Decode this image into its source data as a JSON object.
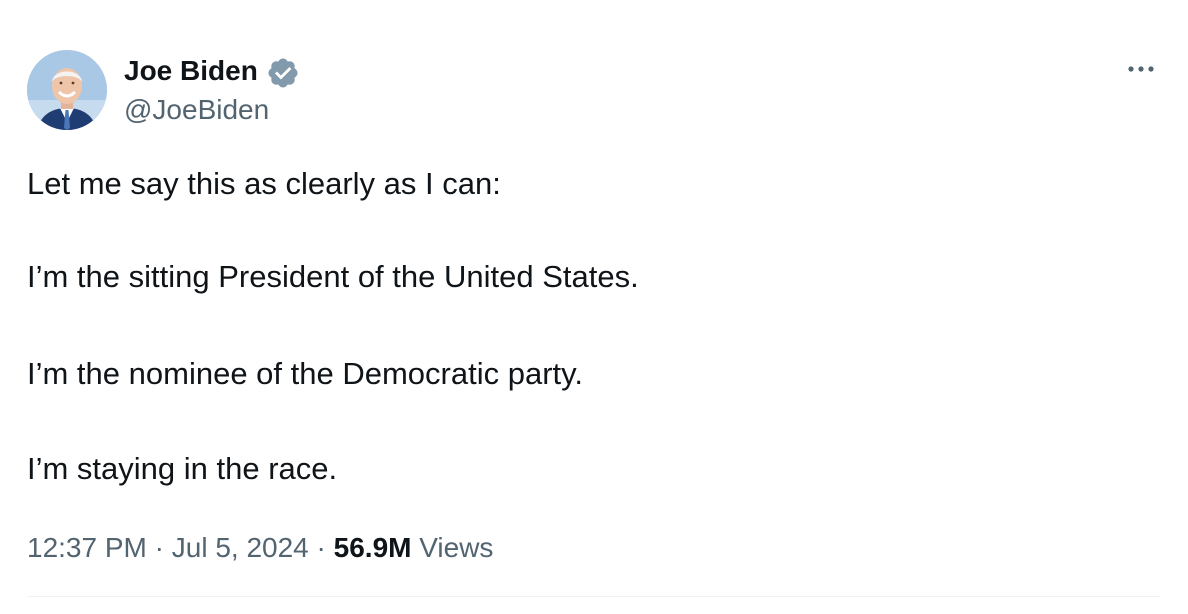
{
  "author": {
    "name": "Joe Biden",
    "handle": "@JoeBiden",
    "verified_badge_color": "#829aab"
  },
  "tweet": {
    "lines": [
      "Let me say this as clearly as I can:",
      "I’m the sitting President of the United States.",
      "I’m the nominee of the Democratic party.",
      "I’m staying in the race."
    ]
  },
  "meta": {
    "time": "12:37 PM",
    "separator": "·",
    "date": "Jul 5, 2024",
    "views_count": "56.9M",
    "views_label": "Views"
  },
  "icons": {
    "more": "more-horizontal-icon",
    "verified": "verified-badge-icon"
  },
  "colors": {
    "text_primary": "#0f1419",
    "text_secondary": "#536471",
    "divider": "#eff3f4"
  }
}
